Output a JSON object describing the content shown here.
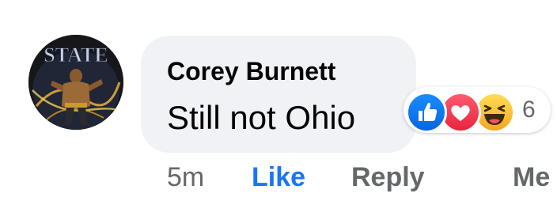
{
  "comment": {
    "author": "Corey Burnett",
    "text": "Still not Ohio",
    "avatar_label": "STATE"
  },
  "reactions": {
    "icons": [
      "like-icon",
      "love-icon",
      "haha-icon"
    ],
    "count": "6",
    "colors": {
      "like": "#1877f2",
      "love": "#f33e58",
      "haha": "#f7b125"
    }
  },
  "actions": {
    "time": "5m",
    "like_label": "Like",
    "reply_label": "Reply",
    "more_label": "Me"
  },
  "colors": {
    "bubble": "#f0f2f5",
    "text": "#050505",
    "secondary": "#65676b",
    "accent": "#1877f2"
  }
}
